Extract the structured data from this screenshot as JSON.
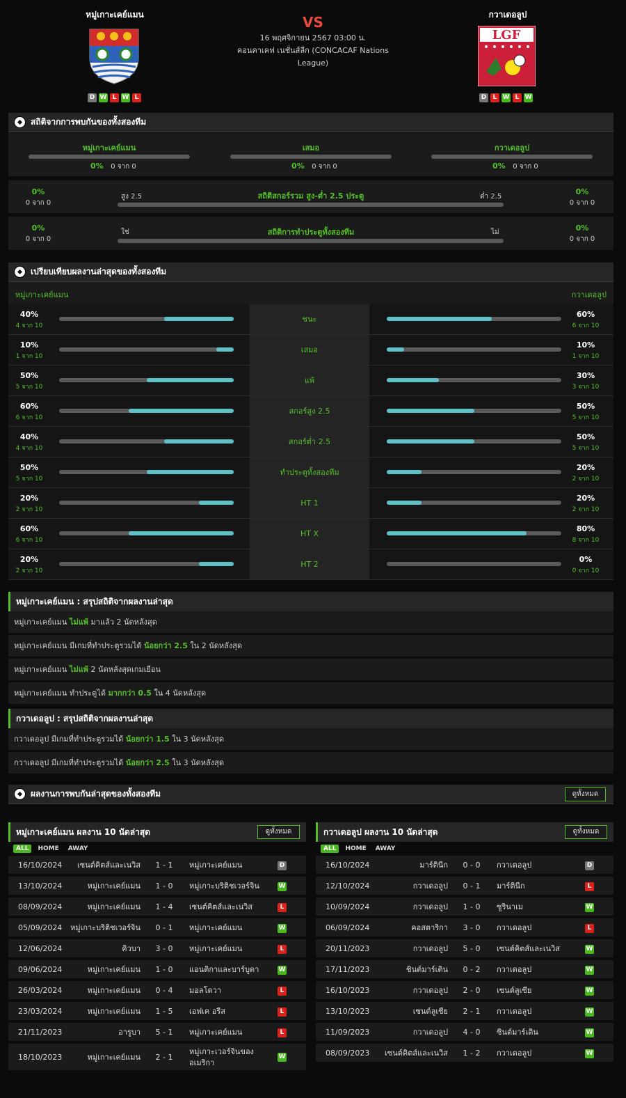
{
  "match": {
    "home": "หมู่เกาะเคย์แมน",
    "away": "กวาเดอลูป",
    "vs": "VS",
    "datetime": "16 พฤศจิกายน 2567 03:00 น.",
    "competition": "คอนคาเคฟ เนชั่นส์ลีก (CONCACAF Nations League)",
    "home_form": [
      "D",
      "W",
      "L",
      "W",
      "L"
    ],
    "away_form": [
      "D",
      "L",
      "W",
      "L",
      "W"
    ],
    "away_logo_text": "LGF"
  },
  "h2h": {
    "title": "สถิติจากการพบกันของทั้งสองทีม",
    "home_label": "หมู่เกาะเคย์แมน",
    "draw_label": "เสมอ",
    "away_label": "กวาเดอลูป",
    "home_pct": "0%",
    "draw_pct": "0%",
    "away_pct": "0%",
    "home_cnt": "0 จาก 0",
    "draw_cnt": "0 จาก 0",
    "away_cnt": "0 จาก 0",
    "ou_title": "สถิติสกอร์รวม สูง-ต่ำ 2.5 ประตู",
    "ou_over": "สูง 2.5",
    "ou_under": "ต่ำ 2.5",
    "ou_left_pct": "0%",
    "ou_left_cnt": "0 จาก 0",
    "ou_right_pct": "0%",
    "ou_right_cnt": "0 จาก 0",
    "btts_title": "สถิติการทำประตูทั้งสองทีม",
    "btts_yes": "ใช่",
    "btts_no": "ไม่",
    "btts_left_pct": "0%",
    "btts_left_cnt": "0 จาก 0",
    "btts_right_pct": "0%",
    "btts_right_cnt": "0 จาก 0"
  },
  "compare": {
    "title": "เปรียบเทียบผลงานล่าสุดของทั้งสองทีม",
    "home_label": "หมู่เกาะเคย์แมน",
    "away_label": "กวาเดอลูป",
    "rows": [
      {
        "label": "ชนะ",
        "hp": "40%",
        "hc": "4 จาก 10",
        "hv": 0.4,
        "ap": "60%",
        "ac": "6 จาก 10",
        "av": 0.6
      },
      {
        "label": "เสมอ",
        "hp": "10%",
        "hc": "1 จาก 10",
        "hv": 0.1,
        "ap": "10%",
        "ac": "1 จาก 10",
        "av": 0.1
      },
      {
        "label": "แพ้",
        "hp": "50%",
        "hc": "5 จาก 10",
        "hv": 0.5,
        "ap": "30%",
        "ac": "3 จาก 10",
        "av": 0.3
      },
      {
        "label": "สกอร์สูง 2.5",
        "hp": "60%",
        "hc": "6 จาก 10",
        "hv": 0.6,
        "ap": "50%",
        "ac": "5 จาก 10",
        "av": 0.5
      },
      {
        "label": "สกอร์ต่ำ 2.5",
        "hp": "40%",
        "hc": "4 จาก 10",
        "hv": 0.4,
        "ap": "50%",
        "ac": "5 จาก 10",
        "av": 0.5
      },
      {
        "label": "ทำประตูทั้งสองทีม",
        "hp": "50%",
        "hc": "5 จาก 10",
        "hv": 0.5,
        "ap": "20%",
        "ac": "2 จาก 10",
        "av": 0.2
      },
      {
        "label": "HT 1",
        "hp": "20%",
        "hc": "2 จาก 10",
        "hv": 0.2,
        "ap": "20%",
        "ac": "2 จาก 10",
        "av": 0.2
      },
      {
        "label": "HT X",
        "hp": "60%",
        "hc": "6 จาก 10",
        "hv": 0.6,
        "ap": "80%",
        "ac": "8 จาก 10",
        "av": 0.8
      },
      {
        "label": "HT 2",
        "hp": "20%",
        "hc": "2 จาก 10",
        "hv": 0.2,
        "ap": "0%",
        "ac": "0 จาก 10",
        "av": 0
      }
    ]
  },
  "home_summary": {
    "title": "หมู่เกาะเคย์แมน : สรุปสถิติจากผลงานล่าสุด",
    "rows": [
      {
        "a": "หมู่เกาะเคย์แมน ",
        "b": "ไม่แพ้",
        "c": " มาแล้ว 2 นัดหลังสุด"
      },
      {
        "a": "หมู่เกาะเคย์แมน  มีเกมที่ทำประตูรวมได้ ",
        "b": "น้อยกว่า 2.5",
        "c": " ใน 2 นัดหลังสุด"
      },
      {
        "a": "หมู่เกาะเคย์แมน ",
        "b": "ไม่แพ้",
        "c": " 2 นัดหลังสุดเกมเยือน"
      },
      {
        "a": "หมู่เกาะเคย์แมน  ทำประตูได้ ",
        "b": "มากกว่า 0.5",
        "c": " ใน 4 นัดหลังสุด"
      }
    ]
  },
  "away_summary": {
    "title": "กวาเดอลูป : สรุปสถิติจากผลงานล่าสุด",
    "rows": [
      {
        "a": "กวาเดอลูป  มีเกมที่ทำประตูรวมได้ ",
        "b": "น้อยกว่า 1.5",
        "c": " ใน 3 นัดหลังสุด"
      },
      {
        "a": "กวาเดอลูป  มีเกมที่ทำประตูรวมได้ ",
        "b": "น้อยกว่า 2.5",
        "c": " ใน 3 นัดหลังสุด"
      }
    ]
  },
  "recent": {
    "title": "ผลงานการพบกันล่าสุดของทั้งสองทีม",
    "view_all": "ดูทั้งหมด",
    "filters": [
      "ALL",
      "HOME",
      "AWAY"
    ],
    "home_title": "หมู่เกาะเคย์แมน ผลงาน 10 นัดล่าสุด",
    "away_title": "กวาเดอลูป ผลงาน 10 นัดล่าสุด",
    "home_matches": [
      {
        "date": "16/10/2024",
        "home": "เซนต์คิตส์และเนวิส",
        "score": "1 - 1",
        "away": "หมู่เกาะเคย์แมน",
        "res": "D"
      },
      {
        "date": "13/10/2024",
        "home": "หมู่เกาะเคย์แมน",
        "score": "1 - 0",
        "away": "หมู่เกาะบริติชเวอร์จิน",
        "res": "W"
      },
      {
        "date": "08/09/2024",
        "home": "หมู่เกาะเคย์แมน",
        "score": "1 - 4",
        "away": "เซนต์คิตส์และเนวิส",
        "res": "L"
      },
      {
        "date": "05/09/2024",
        "home": "หมู่เกาะบริติชเวอร์จิน",
        "score": "0 - 1",
        "away": "หมู่เกาะเคย์แมน",
        "res": "W"
      },
      {
        "date": "12/06/2024",
        "home": "คิวบา",
        "score": "3 - 0",
        "away": "หมู่เกาะเคย์แมน",
        "res": "L"
      },
      {
        "date": "09/06/2024",
        "home": "หมู่เกาะเคย์แมน",
        "score": "1 - 0",
        "away": "แอนติกาและบาร์บูดา",
        "res": "W"
      },
      {
        "date": "26/03/2024",
        "home": "หมู่เกาะเคย์แมน",
        "score": "0 - 4",
        "away": "มอลโดวา",
        "res": "L"
      },
      {
        "date": "23/03/2024",
        "home": "หมู่เกาะเคย์แมน",
        "score": "1 - 5",
        "away": "เอฟเค อรีส",
        "res": "L"
      },
      {
        "date": "21/11/2023",
        "home": "อารูบา",
        "score": "5 - 1",
        "away": "หมู่เกาะเคย์แมน",
        "res": "L"
      },
      {
        "date": "18/10/2023",
        "home": "หมู่เกาะเคย์แมน",
        "score": "2 - 1",
        "away": "หมู่เกาะเวอร์จินของอเมริกา",
        "res": "W"
      }
    ],
    "away_matches": [
      {
        "date": "16/10/2024",
        "home": "มาร์ตินีก",
        "score": "0 - 0",
        "away": "กวาเดอลูป",
        "res": "D"
      },
      {
        "date": "12/10/2024",
        "home": "กวาเดอลูป",
        "score": "0 - 1",
        "away": "มาร์ตินีก",
        "res": "L"
      },
      {
        "date": "10/09/2024",
        "home": "กวาเดอลูป",
        "score": "1 - 0",
        "away": "ซูรินาเม",
        "res": "W"
      },
      {
        "date": "06/09/2024",
        "home": "คอสตาริกา",
        "score": "3 - 0",
        "away": "กวาเดอลูป",
        "res": "L"
      },
      {
        "date": "20/11/2023",
        "home": "กวาเดอลูป",
        "score": "5 - 0",
        "away": "เซนต์คิตส์และเนวิส",
        "res": "W"
      },
      {
        "date": "17/11/2023",
        "home": "ซินต์มาร์เติน",
        "score": "0 - 2",
        "away": "กวาเดอลูป",
        "res": "W"
      },
      {
        "date": "16/10/2023",
        "home": "กวาเดอลูป",
        "score": "2 - 0",
        "away": "เซนต์ลูเซีย",
        "res": "W"
      },
      {
        "date": "13/10/2023",
        "home": "เซนต์ลูเซีย",
        "score": "2 - 1",
        "away": "กวาเดอลูป",
        "res": "W"
      },
      {
        "date": "11/09/2023",
        "home": "กวาเดอลูป",
        "score": "4 - 0",
        "away": "ซินต์มาร์เติน",
        "res": "W"
      },
      {
        "date": "08/09/2023",
        "home": "เซนต์คิตส์และเนวิส",
        "score": "1 - 2",
        "away": "กวาเดอลูป",
        "res": "W"
      }
    ]
  }
}
